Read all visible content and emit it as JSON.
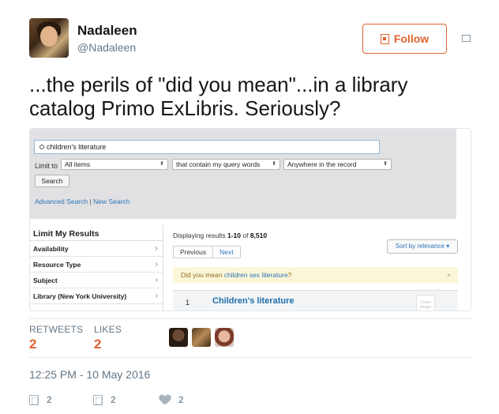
{
  "user": {
    "name": "Nadaleen",
    "handle": "@Nadaleen"
  },
  "follow_label": "Follow",
  "tweet_text": "...the perils of \"did you mean\"...in a library catalog Primo ExLibris. Seriously?",
  "embedded": {
    "search_query": "children's literature",
    "limit_to_label": "Limit to",
    "limit_select": "All items",
    "match_select": "that contain my query words",
    "scope_select": "Anywhere in the record",
    "search_button": "Search",
    "advanced_search": "Advanced Search",
    "link_separator": "|",
    "new_search": "New Search",
    "facets_title": "Limit My Results",
    "facets": [
      "Availability",
      "Resource Type",
      "Subject",
      "Library (New York University)"
    ],
    "displaying_prefix": "Displaying results ",
    "displaying_range": "1-10",
    "displaying_of": " of ",
    "displaying_total": "8,510",
    "pager_previous": "Previous",
    "pager_next": "Next",
    "sort_label": "Sort by relevance ▾",
    "did_you_mean_prefix": "Did you mean ",
    "did_you_mean_suggestion": "children sex literature",
    "did_you_mean_suffix": "?",
    "dismiss": "×",
    "result_number": "1",
    "result_title": "Children's literature",
    "cover_text": "Cover image"
  },
  "stats": {
    "retweets_label": "RETWEETS",
    "retweets_count": "2",
    "likes_label": "LIKES",
    "likes_count": "2"
  },
  "timestamp": "12:25 PM - 10 May 2016",
  "actions": {
    "reply_count": "2",
    "retweet_count": "2",
    "like_count": "2"
  },
  "colors": {
    "accent": "#e0622e",
    "link": "#2a74b8",
    "muted": "#657786"
  },
  "icons": [
    "follow-user-icon",
    "more-options-icon",
    "reply-icon",
    "retweet-icon",
    "heart-icon",
    "search-icon",
    "chevron-right-icon"
  ]
}
